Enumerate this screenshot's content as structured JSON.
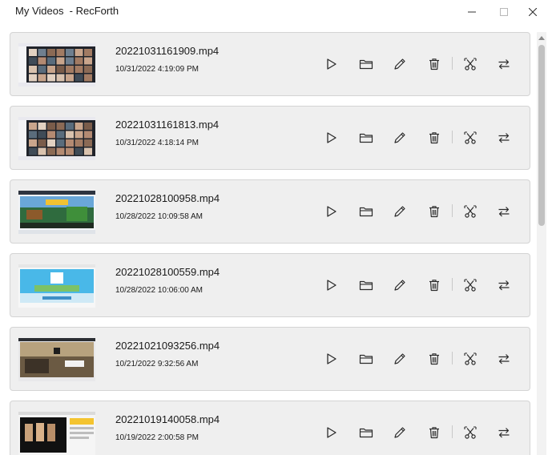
{
  "window": {
    "title": "My Videos  - RecForth",
    "controls": [
      "minimize-icon",
      "maximize-icon",
      "close-icon"
    ]
  },
  "actions": [
    "play-icon",
    "folder-icon",
    "pencil-icon",
    "trash-icon",
    "scissors-icon",
    "swap-arrows-icon"
  ],
  "videos": [
    {
      "name": "20221031161909.mp4",
      "date": "10/31/2022 4:19:09 PM"
    },
    {
      "name": "20221031161813.mp4",
      "date": "10/31/2022 4:18:14 PM"
    },
    {
      "name": "20221028100958.mp4",
      "date": "10/28/2022 10:09:58 AM"
    },
    {
      "name": "20221028100559.mp4",
      "date": "10/28/2022 10:06:00 AM"
    },
    {
      "name": "20221021093256.mp4",
      "date": "10/21/2022 9:32:56 AM"
    },
    {
      "name": "20221019140058.mp4",
      "date": "10/19/2022 2:00:58 PM"
    }
  ],
  "colors": {
    "card_bg": "#efefef",
    "card_border": "#d4d4d4",
    "icon": "#2b2b2b",
    "scroll_thumb": "#c1c1c1"
  }
}
